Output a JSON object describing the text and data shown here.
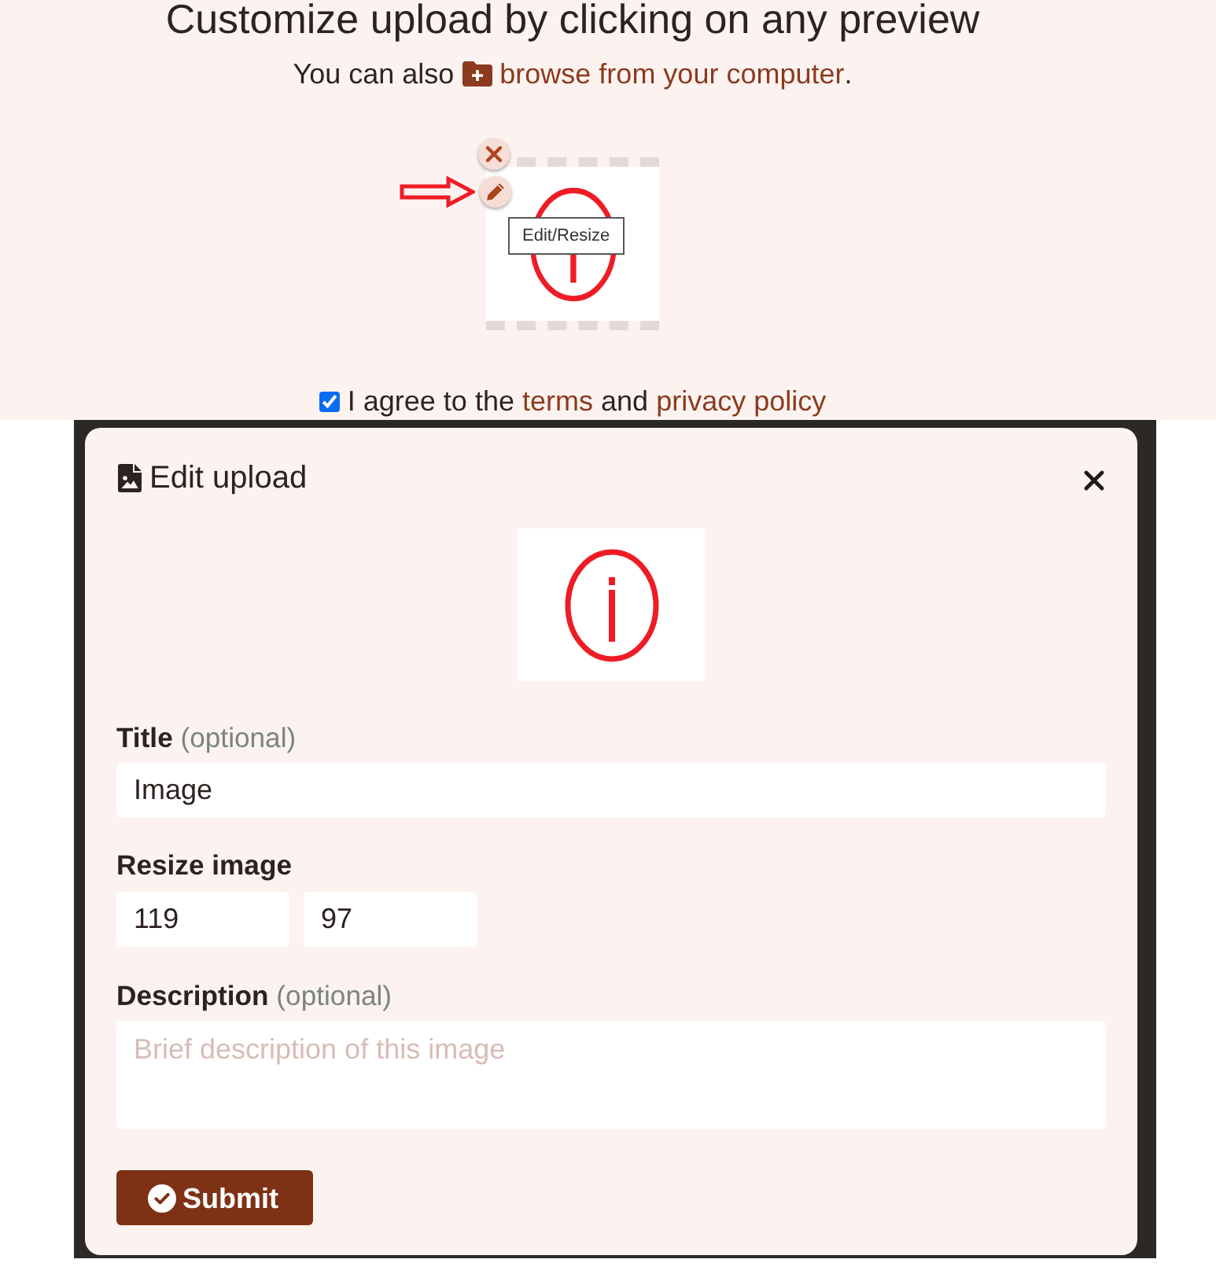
{
  "heading": "Customize upload by clicking on any preview",
  "browse_line": {
    "text": "You can also",
    "link": "browse from your computer",
    "end": "."
  },
  "preview": {
    "tooltip": "Edit/Resize"
  },
  "agreement": {
    "checked": true,
    "parts": [
      {
        "kind": "text",
        "text": "I agree to the"
      },
      {
        "kind": "link",
        "text": "terms"
      },
      {
        "kind": "text",
        "text": "and"
      },
      {
        "kind": "link",
        "text": "privacy policy"
      }
    ]
  },
  "modal": {
    "title": "Edit upload",
    "fields": [
      {
        "kind": "text",
        "label": "Title",
        "note": "(optional)",
        "value": "Image"
      },
      {
        "kind": "size",
        "label": "Resize image",
        "values": [
          "119",
          "97"
        ]
      },
      {
        "kind": "textarea",
        "label": "Description",
        "note": "(optional)",
        "placeholder": "Brief description of this image"
      }
    ],
    "submit": "Submit"
  }
}
